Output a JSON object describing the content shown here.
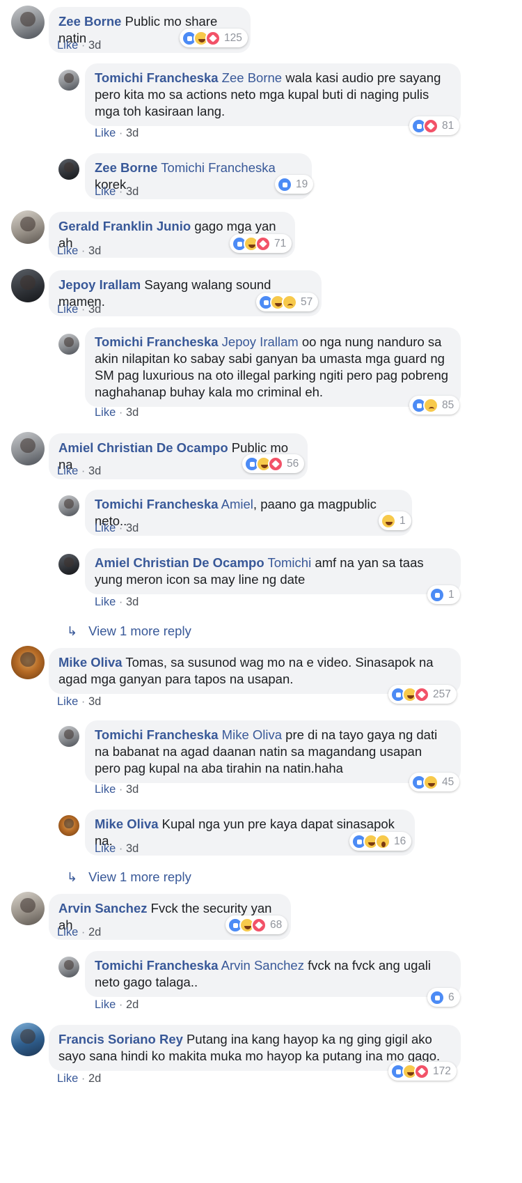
{
  "reactions": {
    "like_color": "#4c8bf5",
    "love_color": "#f25268",
    "emoji_color": "#f7c94b"
  },
  "comments": [
    {
      "author": "Zee Borne",
      "mention": "",
      "text": "Public mo share natin",
      "like_label": "Like",
      "time": "3d",
      "reaction_count": "125",
      "reaction_icons": [
        "like-icon",
        "haha-icon",
        "love-icon"
      ]
    },
    {
      "author": "Tomichi Francheska",
      "mention": "Zee Borne",
      "text": "wala kasi audio pre sayang pero kita mo sa actions neto mga kupal buti di naging pulis mga toh kasiraan lang.",
      "like_label": "Like",
      "time": "3d",
      "reaction_count": "81",
      "reaction_icons": [
        "like-icon",
        "love-icon"
      ]
    },
    {
      "author": "Zee Borne",
      "mention": "Tomichi Francheska",
      "text": "korek",
      "like_label": "Like",
      "time": "3d",
      "reaction_count": "19",
      "reaction_icons": [
        "like-icon"
      ]
    },
    {
      "author": "Gerald Franklin Junio",
      "mention": "",
      "text": "gago mga yan ah",
      "like_label": "Like",
      "time": "3d",
      "reaction_count": "71",
      "reaction_icons": [
        "like-icon",
        "haha-icon",
        "love-icon"
      ]
    },
    {
      "author": "Jepoy Irallam",
      "mention": "",
      "text": "Sayang walang sound mamen.",
      "like_label": "Like",
      "time": "3d",
      "reaction_count": "57",
      "reaction_icons": [
        "like-icon",
        "haha-icon",
        "sad-icon"
      ]
    },
    {
      "author": "Tomichi Francheska",
      "mention": "Jepoy Irallam",
      "text": "oo nga nung nanduro sa akin nilapitan ko sabay sabi ganyan ba umasta mga guard ng SM pag luxurious na oto illegal parking ngiti pero pag pobreng naghahanap buhay kala mo criminal eh.",
      "like_label": "Like",
      "time": "3d",
      "reaction_count": "85",
      "reaction_icons": [
        "like-icon",
        "sad-icon"
      ]
    },
    {
      "author": "Amiel Christian De Ocampo",
      "mention": "",
      "text": "Public mo na",
      "like_label": "Like",
      "time": "3d",
      "reaction_count": "56",
      "reaction_icons": [
        "like-icon",
        "haha-icon",
        "love-icon"
      ]
    },
    {
      "author": "Tomichi Francheska",
      "mention": "Amiel",
      "text": ", paano ga magpublic neto..",
      "like_label": "Like",
      "time": "3d",
      "reaction_count": "1",
      "reaction_icons": [
        "haha-icon"
      ]
    },
    {
      "author": "Amiel Christian De Ocampo",
      "mention": "Tomichi",
      "text": "amf na yan sa taas yung meron icon sa may line ng date",
      "like_label": "Like",
      "time": "3d",
      "reaction_count": "1",
      "reaction_icons": [
        "like-icon"
      ]
    },
    {
      "author": "Mike Oliva",
      "mention": "",
      "text": "Tomas, sa susunod wag mo na e video. Sinasapok na agad mga ganyan para tapos na usapan.",
      "like_label": "Like",
      "time": "3d",
      "reaction_count": "257",
      "reaction_icons": [
        "like-icon",
        "haha-icon",
        "love-icon"
      ]
    },
    {
      "author": "Tomichi Francheska",
      "mention": "Mike Oliva",
      "text": "pre di na tayo gaya ng dati na babanat na agad daanan natin sa magandang usapan pero pag kupal na aba tirahin na natin.haha",
      "like_label": "Like",
      "time": "3d",
      "reaction_count": "45",
      "reaction_icons": [
        "like-icon",
        "haha-icon"
      ]
    },
    {
      "author": "Mike Oliva",
      "mention": "",
      "text": "Kupal nga yun pre kaya dapat sinasapok na.",
      "like_label": "Like",
      "time": "3d",
      "reaction_count": "16",
      "reaction_icons": [
        "like-icon",
        "haha-icon",
        "wow-icon"
      ]
    },
    {
      "author": "Arvin Sanchez",
      "mention": "",
      "text": "Fvck the security yan ah",
      "like_label": "Like",
      "time": "2d",
      "reaction_count": "68",
      "reaction_icons": [
        "like-icon",
        "haha-icon",
        "love-icon"
      ]
    },
    {
      "author": "Tomichi Francheska",
      "mention": "Arvin Sanchez",
      "text": "fvck na fvck ang ugali neto gago talaga..",
      "like_label": "Like",
      "time": "2d",
      "reaction_count": "6",
      "reaction_icons": [
        "like-icon"
      ]
    },
    {
      "author": "Francis Soriano Rey",
      "mention": "",
      "text": "Putang ina kang hayop ka ng ging gigil ako sayo sana hindi ko makita muka mo hayop ka putang ina mo gago.",
      "like_label": "Like",
      "time": "2d",
      "reaction_count": "172",
      "reaction_icons": [
        "like-icon",
        "haha-icon",
        "love-icon"
      ]
    }
  ],
  "view_more": [
    {
      "label": "View 1 more reply",
      "icon": "reply-arrow-icon"
    },
    {
      "label": "View 1 more reply",
      "icon": "reply-arrow-icon"
    }
  ]
}
